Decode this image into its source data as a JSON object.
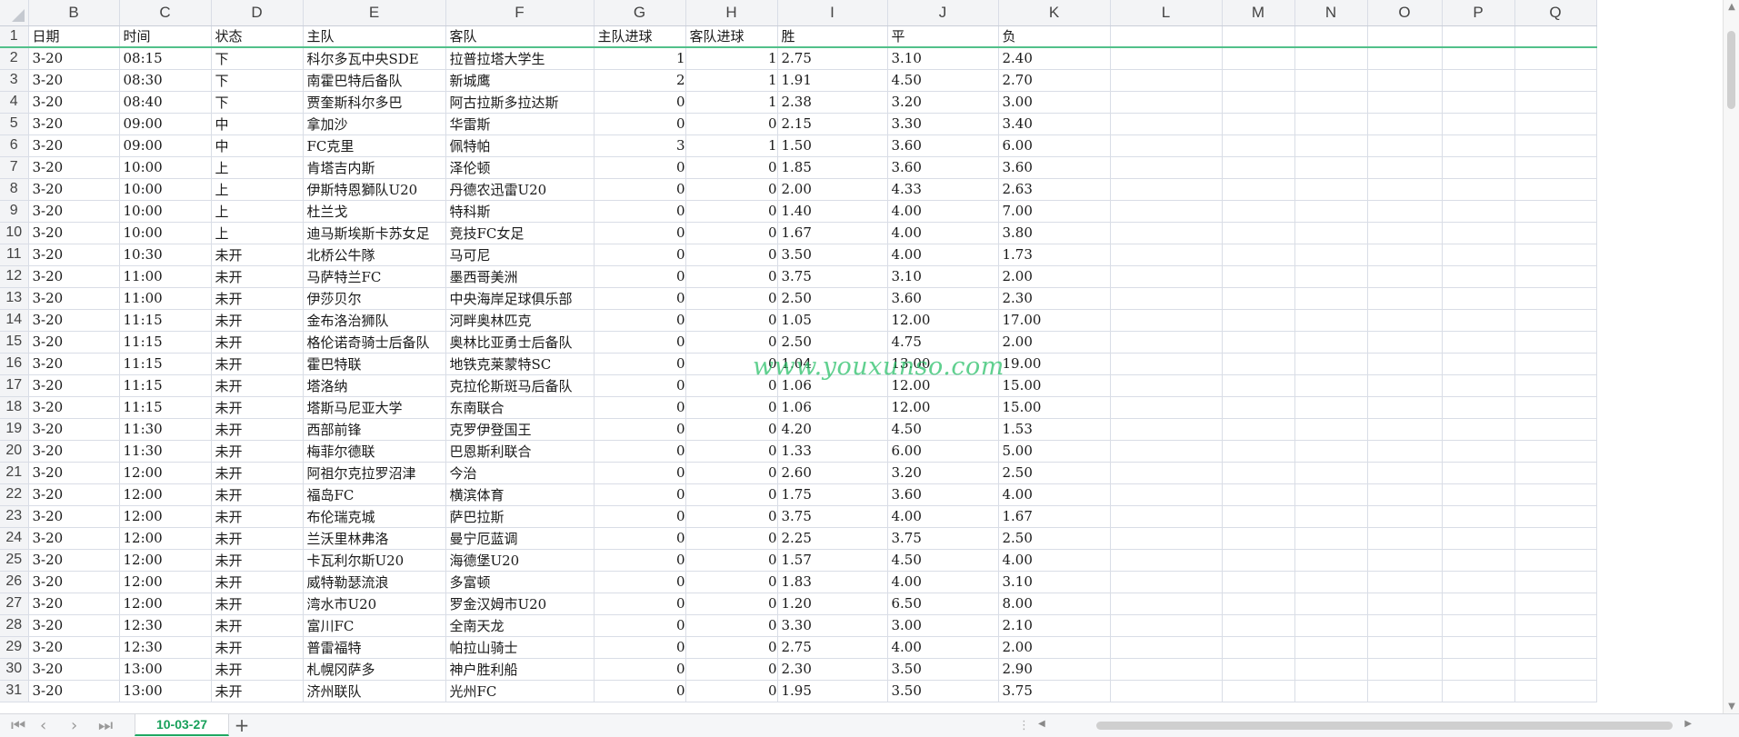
{
  "columns": [
    "B",
    "C",
    "D",
    "E",
    "F",
    "G",
    "H",
    "I",
    "J",
    "K",
    "L",
    "M",
    "N",
    "O",
    "P",
    "Q"
  ],
  "header_row": {
    "num": "1",
    "cells": [
      "日期",
      "时间",
      "状态",
      "主队",
      "客队",
      "主队进球",
      "客队进球",
      "胜",
      "平",
      "负"
    ]
  },
  "rows": [
    {
      "num": "2",
      "d": "3-20",
      "t": "08:15",
      "s": "下",
      "h": "科尔多瓦中央SDE",
      "a": "拉普拉塔大学生",
      "hg": "1",
      "ag": "1",
      "w": "2.75",
      "dr": "3.10",
      "l": "2.40"
    },
    {
      "num": "3",
      "d": "3-20",
      "t": "08:30",
      "s": "下",
      "h": "南霍巴特后备队",
      "a": "新城鹰",
      "hg": "2",
      "ag": "1",
      "w": "1.91",
      "dr": "4.50",
      "l": "2.70"
    },
    {
      "num": "4",
      "d": "3-20",
      "t": "08:40",
      "s": "下",
      "h": "贾奎斯科尔多巴",
      "a": "阿古拉斯多拉达斯",
      "hg": "0",
      "ag": "1",
      "w": "2.38",
      "dr": "3.20",
      "l": "3.00"
    },
    {
      "num": "5",
      "d": "3-20",
      "t": "09:00",
      "s": "中",
      "h": "拿加沙",
      "a": "华雷斯",
      "hg": "0",
      "ag": "0",
      "w": "2.15",
      "dr": "3.30",
      "l": "3.40"
    },
    {
      "num": "6",
      "d": "3-20",
      "t": "09:00",
      "s": "中",
      "h": "FC克里",
      "a": "佩特帕",
      "hg": "3",
      "ag": "1",
      "w": "1.50",
      "dr": "3.60",
      "l": "6.00"
    },
    {
      "num": "7",
      "d": "3-20",
      "t": "10:00",
      "s": "上",
      "h": "肯塔吉内斯",
      "a": "泽伦顿",
      "hg": "0",
      "ag": "0",
      "w": "1.85",
      "dr": "3.60",
      "l": "3.60"
    },
    {
      "num": "8",
      "d": "3-20",
      "t": "10:00",
      "s": "上",
      "h": "伊斯特恩獅队U20",
      "a": "丹德农迅雷U20",
      "hg": "0",
      "ag": "0",
      "w": "2.00",
      "dr": "4.33",
      "l": "2.63"
    },
    {
      "num": "9",
      "d": "3-20",
      "t": "10:00",
      "s": "上",
      "h": "杜兰戈",
      "a": "特科斯",
      "hg": "0",
      "ag": "0",
      "w": "1.40",
      "dr": "4.00",
      "l": "7.00"
    },
    {
      "num": "10",
      "d": "3-20",
      "t": "10:00",
      "s": "上",
      "h": "迪马斯埃斯卡苏女足",
      "a": "竞技FC女足",
      "hg": "0",
      "ag": "0",
      "w": "1.67",
      "dr": "4.00",
      "l": "3.80"
    },
    {
      "num": "11",
      "d": "3-20",
      "t": "10:30",
      "s": "未开",
      "h": "北桥公牛隊",
      "a": "马可尼",
      "hg": "0",
      "ag": "0",
      "w": "3.50",
      "dr": "4.00",
      "l": "1.73"
    },
    {
      "num": "12",
      "d": "3-20",
      "t": "11:00",
      "s": "未开",
      "h": "马萨特兰FC",
      "a": "墨西哥美洲",
      "hg": "0",
      "ag": "0",
      "w": "3.75",
      "dr": "3.10",
      "l": "2.00"
    },
    {
      "num": "13",
      "d": "3-20",
      "t": "11:00",
      "s": "未开",
      "h": "伊莎贝尔",
      "a": "中央海岸足球俱乐部",
      "hg": "0",
      "ag": "0",
      "w": "2.50",
      "dr": "3.60",
      "l": "2.30"
    },
    {
      "num": "14",
      "d": "3-20",
      "t": "11:15",
      "s": "未开",
      "h": "金布洛治狮队",
      "a": "河畔奥林匹克",
      "hg": "0",
      "ag": "0",
      "w": "1.05",
      "dr": "12.00",
      "l": "17.00"
    },
    {
      "num": "15",
      "d": "3-20",
      "t": "11:15",
      "s": "未开",
      "h": "格伦诺奇骑士后备队",
      "a": "奥林比亚勇士后备队",
      "hg": "0",
      "ag": "0",
      "w": "2.50",
      "dr": "4.75",
      "l": "2.00"
    },
    {
      "num": "16",
      "d": "3-20",
      "t": "11:15",
      "s": "未开",
      "h": "霍巴特联",
      "a": "地铁克莱蒙特SC",
      "hg": "0",
      "ag": "0",
      "w": "1.04",
      "dr": "13.00",
      "l": "19.00"
    },
    {
      "num": "17",
      "d": "3-20",
      "t": "11:15",
      "s": "未开",
      "h": "塔洛纳",
      "a": "克拉伦斯斑马后备队",
      "hg": "0",
      "ag": "0",
      "w": "1.06",
      "dr": "12.00",
      "l": "15.00"
    },
    {
      "num": "18",
      "d": "3-20",
      "t": "11:15",
      "s": "未开",
      "h": "塔斯马尼亚大学",
      "a": "东南联合",
      "hg": "0",
      "ag": "0",
      "w": "1.06",
      "dr": "12.00",
      "l": "15.00"
    },
    {
      "num": "19",
      "d": "3-20",
      "t": "11:30",
      "s": "未开",
      "h": "西部前锋",
      "a": "克罗伊登国王",
      "hg": "0",
      "ag": "0",
      "w": "4.20",
      "dr": "4.50",
      "l": "1.53"
    },
    {
      "num": "20",
      "d": "3-20",
      "t": "11:30",
      "s": "未开",
      "h": "梅菲尔德联",
      "a": "巴恩斯利联合",
      "hg": "0",
      "ag": "0",
      "w": "1.33",
      "dr": "6.00",
      "l": "5.00"
    },
    {
      "num": "21",
      "d": "3-20",
      "t": "12:00",
      "s": "未开",
      "h": "阿祖尔克拉罗沼津",
      "a": "今治",
      "hg": "0",
      "ag": "0",
      "w": "2.60",
      "dr": "3.20",
      "l": "2.50"
    },
    {
      "num": "22",
      "d": "3-20",
      "t": "12:00",
      "s": "未开",
      "h": "福岛FC",
      "a": "横滨体育",
      "hg": "0",
      "ag": "0",
      "w": "1.75",
      "dr": "3.60",
      "l": "4.00"
    },
    {
      "num": "23",
      "d": "3-20",
      "t": "12:00",
      "s": "未开",
      "h": "布伦瑞克城",
      "a": "萨巴拉斯",
      "hg": "0",
      "ag": "0",
      "w": "3.75",
      "dr": "4.00",
      "l": "1.67"
    },
    {
      "num": "24",
      "d": "3-20",
      "t": "12:00",
      "s": "未开",
      "h": "兰沃里林弗洛",
      "a": "曼宁厄蓝调",
      "hg": "0",
      "ag": "0",
      "w": "2.25",
      "dr": "3.75",
      "l": "2.50"
    },
    {
      "num": "25",
      "d": "3-20",
      "t": "12:00",
      "s": "未开",
      "h": "卡瓦利尔斯U20",
      "a": "海德堡U20",
      "hg": "0",
      "ag": "0",
      "w": "1.57",
      "dr": "4.50",
      "l": "4.00"
    },
    {
      "num": "26",
      "d": "3-20",
      "t": "12:00",
      "s": "未开",
      "h": "威特勒瑟流浪",
      "a": "多富顿",
      "hg": "0",
      "ag": "0",
      "w": "1.83",
      "dr": "4.00",
      "l": "3.10"
    },
    {
      "num": "27",
      "d": "3-20",
      "t": "12:00",
      "s": "未开",
      "h": "湾水市U20",
      "a": "罗金汉姆市U20",
      "hg": "0",
      "ag": "0",
      "w": "1.20",
      "dr": "6.50",
      "l": "8.00"
    },
    {
      "num": "28",
      "d": "3-20",
      "t": "12:30",
      "s": "未开",
      "h": "富川FC",
      "a": "全南天龙",
      "hg": "0",
      "ag": "0",
      "w": "3.30",
      "dr": "3.00",
      "l": "2.10"
    },
    {
      "num": "29",
      "d": "3-20",
      "t": "12:30",
      "s": "未开",
      "h": "普雷福特",
      "a": "帕拉山骑士",
      "hg": "0",
      "ag": "0",
      "w": "2.75",
      "dr": "4.00",
      "l": "2.00"
    },
    {
      "num": "30",
      "d": "3-20",
      "t": "13:00",
      "s": "未开",
      "h": "札幌冈萨多",
      "a": "神户胜利船",
      "hg": "0",
      "ag": "0",
      "w": "2.30",
      "dr": "3.50",
      "l": "2.90"
    },
    {
      "num": "31",
      "d": "3-20",
      "t": "13:00",
      "s": "未开",
      "h": "济州联队",
      "a": "光州FC",
      "hg": "0",
      "ag": "0",
      "w": "1.95",
      "dr": "3.50",
      "l": "3.75"
    }
  ],
  "watermark": "www.youxunso.com",
  "sheet_tab": "10-03-27",
  "icons": {
    "first": "first-sheet-icon",
    "prev": "prev-sheet-icon",
    "next": "next-sheet-icon",
    "last": "last-sheet-icon",
    "add": "add-sheet-icon",
    "splitter": "splitter-icon"
  },
  "colors": {
    "accent": "#20a862",
    "tab_text": "#17a05a",
    "freeze_line": "#52c08a",
    "watermark": "#22be64"
  }
}
